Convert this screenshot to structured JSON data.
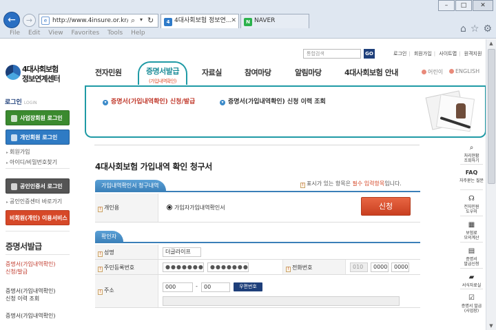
{
  "browser": {
    "url": "http://www.4insure.or.kr/ins4/",
    "tabs": [
      {
        "label": "4대사회보험 정보연...",
        "favicon": "4"
      },
      {
        "label": "NAVER",
        "favicon": "N"
      }
    ],
    "menu": [
      "File",
      "Edit",
      "View",
      "Favorites",
      "Tools",
      "Help"
    ],
    "icons": [
      "back-arrow-icon",
      "forward-arrow-icon",
      "search-icon",
      "refresh-icon",
      "home-icon",
      "star-icon",
      "gear-icon"
    ]
  },
  "header": {
    "logo_line1": "4대사회보험",
    "logo_line2": "정보연계센터",
    "search_placeholder": "통합검색",
    "go_label": "GO",
    "util_links": [
      "로그인",
      "회원가입",
      "사이트맵",
      "원격지원"
    ],
    "nav": [
      "전자민원",
      "증명서발급",
      "자료실",
      "참여마당",
      "알림마당",
      "4대사회보험 안내"
    ],
    "nav_active_sub": "(가입내역확인)",
    "lang": [
      "어린이",
      "ENGLISH"
    ]
  },
  "submenu": {
    "items": [
      "증명서(가입내역확인) 신청/발급",
      "증명서(가입내역확인) 신청 이력 조회"
    ]
  },
  "sidebar": {
    "login_title": "로그인",
    "login_sub": "LOGIN",
    "biz_login": "사업장회원 로그인",
    "personal_login": "개인회원 로그인",
    "join": "회원가입",
    "find_id": "아이디/비밀번호찾기",
    "cert_login": "공인인증서 로그인",
    "cert_shortcut": "공인인증센터 바로가기",
    "nonmember": "비회원(개인) 이용서비스",
    "section_title": "증명서발급",
    "section_items": [
      {
        "line1": "증명서(가입내역확인)",
        "line2": "신청/발급"
      },
      {
        "line1": "증명서(가입내역확인)",
        "line2": "신청 이력 조회"
      },
      {
        "line1": "증명서(가입내역확인)",
        "line2": ""
      }
    ]
  },
  "quick": [
    {
      "icon": "magnifier-icon",
      "line1": "처리현황",
      "line2": "조회하기"
    },
    {
      "icon": "faq-icon",
      "line1": "FAQ",
      "line2": "자주묻는 질문"
    },
    {
      "icon": "headset-icon",
      "line1": "전자민원",
      "line2": "도우미"
    },
    {
      "icon": "calculator-icon",
      "line1": "보험료",
      "line2": "모의계산"
    },
    {
      "icon": "document-icon",
      "line1": "증명서",
      "line2": "발급신청"
    },
    {
      "icon": "folder-icon",
      "line1": "서식자료실",
      "line2": ""
    },
    {
      "icon": "certificate-icon",
      "line1": "증명서 발급",
      "line2": "(사업장)"
    }
  ],
  "main": {
    "title": "4대사회보험 가입내역 확인 청구서",
    "section1": "가입내역확인서 청구내역",
    "req_note_pre": "표시가 있는 항목은",
    "req_note_req": "필수 입력항목",
    "req_note_post": "입니다.",
    "purpose_label": "개인용",
    "purpose_radio": "가입자가입내역확인서",
    "apply_label": "신청",
    "section2": "확인자",
    "name_label": "성명",
    "name_value": "더글라이프",
    "rrn_label": "주민등록번호",
    "rrn_front": "●●●●●●●",
    "rrn_back": "●●●●●●●",
    "phone_label": "전화번호",
    "phone": [
      "010",
      "0000",
      "0000"
    ],
    "addr_label": "주소",
    "zip1": "000",
    "zip_sep": "-",
    "zip2": "00",
    "zip_button": "우편번호"
  }
}
